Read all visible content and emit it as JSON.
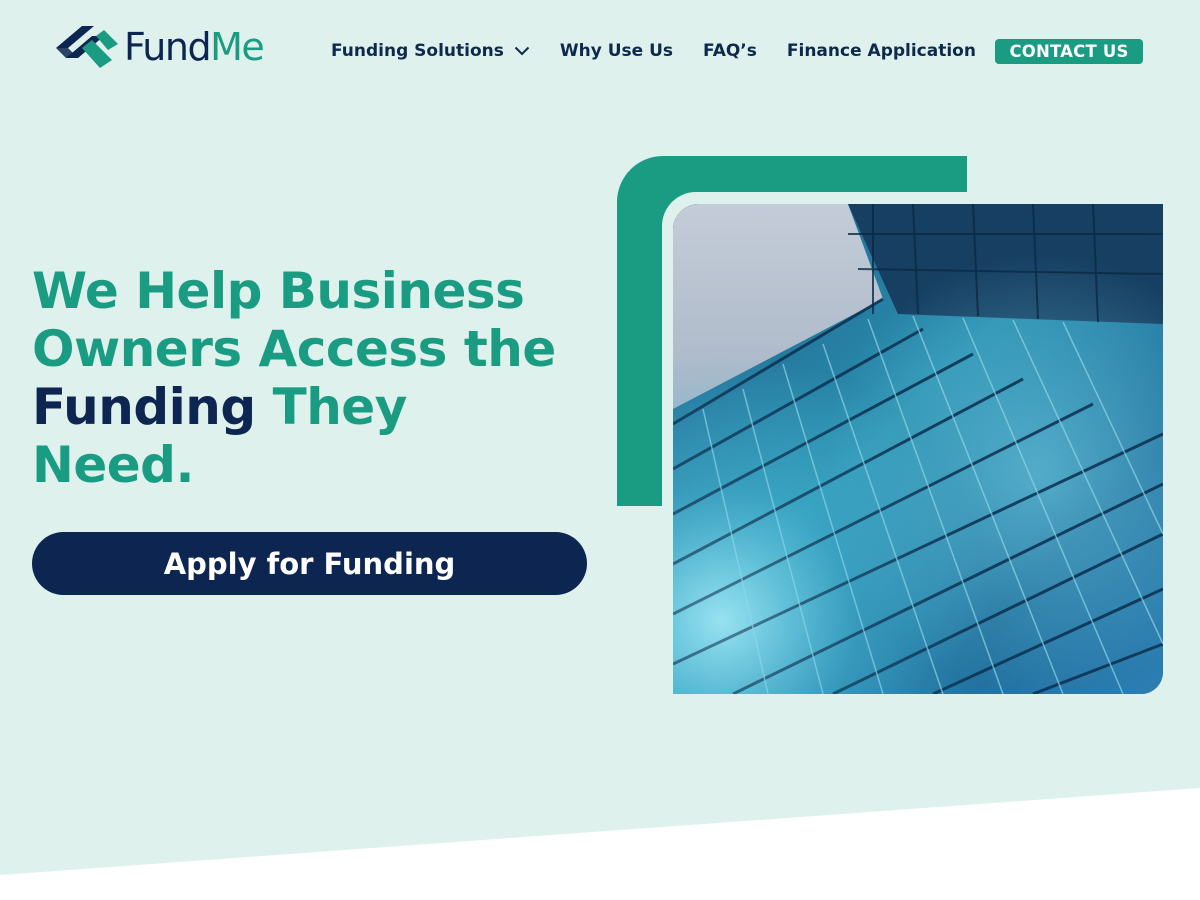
{
  "brand": {
    "name_part1": "Fund",
    "name_part2": "Me",
    "primary_color": "#1a9c82",
    "navy_color": "#0d2551",
    "background_color": "#dff1ec"
  },
  "nav": {
    "items": [
      {
        "label": "Funding Solutions",
        "has_dropdown": true,
        "icon": "chevron-down-icon"
      },
      {
        "label": "Why Use Us"
      },
      {
        "label": "FAQ’s"
      },
      {
        "label": "Finance Application"
      }
    ],
    "contact_label": "CONTACT US"
  },
  "hero": {
    "line1": "We Help Business",
    "line2": "Owners Access the",
    "line3_navy": "Funding",
    "line3_rest": " They",
    "line4": "Need.",
    "cta_label": "Apply for Funding",
    "image_alt": "glass-building-photo"
  }
}
